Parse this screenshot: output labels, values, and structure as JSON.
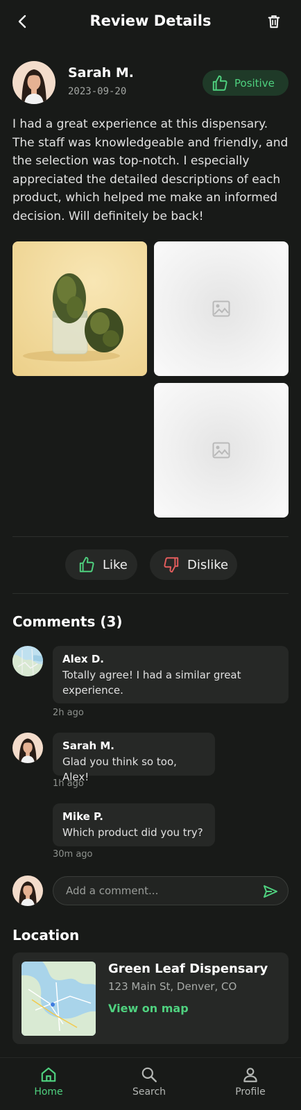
{
  "header": {
    "title": "Review Details",
    "back_icon": "chevron-left-icon",
    "delete_icon": "trash-icon"
  },
  "review": {
    "author": "Sarah M.",
    "date": "2023-09-20",
    "sentiment": "Positive",
    "text": "I had a great experience at this dispensary. The staff was knowledgeable and friendly, and the selection was top-notch. I especially appreciated the detailed descriptions of each product, which helped me make an informed decision. Will definitely be back!"
  },
  "reactions": {
    "like": "Like",
    "dislike": "Dislike"
  },
  "comments": {
    "title": "Comments (3)",
    "items": [
      {
        "author": "Alex D.",
        "text": "Totally agree! I had a similar great experience.",
        "time": "2h ago"
      },
      {
        "author": "Sarah M.",
        "text": "Glad you think so too, Alex!",
        "time": "1h ago"
      },
      {
        "author": "Mike P.",
        "text": "Which product did you try?",
        "time": "30m ago"
      }
    ],
    "input_placeholder": "Add a comment..."
  },
  "location": {
    "title": "Location",
    "name": "Green Leaf Dispensary",
    "address": "123 Main St, Denver, CO",
    "link": "View on map"
  },
  "nav": {
    "home": "Home",
    "search": "Search",
    "profile": "Profile"
  },
  "colors": {
    "background": "#181a18",
    "accent": "#4fd17f",
    "dislike": "#e35d5d",
    "surface": "#262826"
  }
}
